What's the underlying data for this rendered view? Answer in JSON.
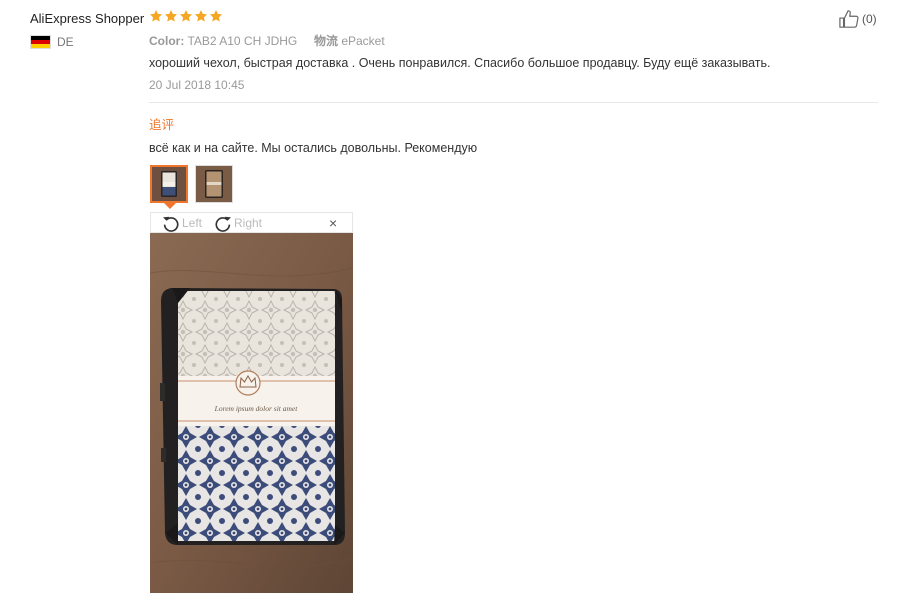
{
  "reviewer": {
    "name": "AliExpress Shopper",
    "country": "DE",
    "flag_colors": [
      "#000000",
      "#dd0000",
      "#ffce00"
    ]
  },
  "rating": {
    "stars": 5,
    "star_color": "#f5a623",
    "icon": "star-icon"
  },
  "helpful": {
    "count_label": "(0)",
    "icon": "thumbs-up-icon"
  },
  "order_meta": {
    "color_label": "Color:",
    "color_value": "TAB2 A10 CH JDHG",
    "shipping_label": "物流",
    "shipping_value": "ePacket"
  },
  "review": {
    "text": "хороший чехол, быстрая доставка . Очень понравился. Спасибо большое продавцу. Буду ещё заказывать.",
    "date": "20 Jul 2018 10:45"
  },
  "followup": {
    "tag": "追评",
    "tag_color": "#f0762d",
    "text": "всё как и на сайте. Мы остались довольны. Рекомендую"
  },
  "thumbnails": [
    {
      "selected": true
    },
    {
      "selected": false
    }
  ],
  "viewer": {
    "rotate_left_label": "Left",
    "rotate_right_label": "Right",
    "close_label": "×",
    "photo_caption": "Lorem ipsum dolor sit amet"
  },
  "accent_color": "#f0762d"
}
